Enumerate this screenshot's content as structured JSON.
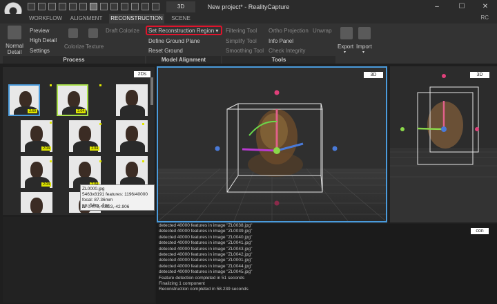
{
  "window": {
    "title": "New project* - RealityCapture",
    "tab3d": "3D",
    "rc": "RC"
  },
  "ribbon_tabs": [
    "WORKFLOW",
    "ALIGNMENT",
    "RECONSTRUCTION",
    "SCENE"
  ],
  "ribbon": {
    "normal_detail": "Normal\nDetail",
    "preview": "Preview",
    "high_detail": "High Detail",
    "settings": "Settings",
    "colorize": "Colorize",
    "texture": "Texture",
    "draft_colorize": "Draft Colorize",
    "set_region": "Set Reconstruction Region",
    "define_ground": "Define Ground Plane",
    "reset_ground": "Reset Ground",
    "filtering_tool": "Filtering Tool",
    "simplify_tool": "Simplify Tool",
    "smoothing_tool": "Smoothing Tool",
    "ortho_projection": "Ortho Projection",
    "unwrap": "Unwrap",
    "info_panel": "Info Panel",
    "check_integrity": "Check Integrity",
    "export": "Export",
    "import": "Import",
    "groups": {
      "process": "Process",
      "model_alignment": "Model Alignment",
      "tools": "Tools"
    }
  },
  "panel_2ds": {
    "badge": "2Ds",
    "thumb_labels": [
      "2.69",
      "2.04",
      "",
      "2.04",
      "2.04",
      "",
      "2.04",
      "2.04",
      ""
    ],
    "tooltip": {
      "name": "ZL0000.jpg",
      "line1": "5463x8191 features: 1196/40000",
      "line2": "focal: 87.36mm",
      "line3": "pp: 64px,-3px",
      "line4": "Δ: 0.478,-0.823,-42.906"
    }
  },
  "viewport_main": {
    "badge": "3D"
  },
  "viewport_side": {
    "badge": "3D"
  },
  "console": {
    "badge": "con",
    "lines": [
      "detected 40000 features in image \"ZL0038.jpg\"",
      "detected 40000 features in image \"ZL0039.jpg\"",
      "detected 40000 features in image \"ZL0040.jpg\"",
      "detected 40000 features in image \"ZL0041.jpg\"",
      "detected 40000 features in image \"ZL0043.jpg\"",
      "detected 40000 features in image \"ZL0042.jpg\"",
      "detected 40000 features in image \"ZL0001.jpg\"",
      "detected 40000 features in image \"ZL0044.jpg\"",
      "detected 40000 features in image \"ZL0045.jpg\"",
      "Feature detection completed in 51 seconds",
      "Finalizing 1 component",
      "Reconstruction completed in 58.239 seconds"
    ]
  },
  "colors": {
    "accent": "#4a9bdc",
    "highlight": "#e0142c",
    "lime": "#dfe600"
  }
}
